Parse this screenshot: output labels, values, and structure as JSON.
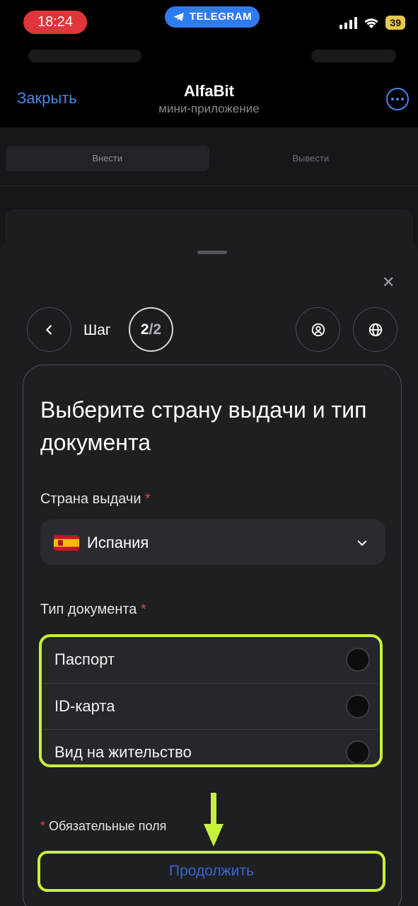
{
  "status_bar": {
    "time": "18:24",
    "app_badge": "TELEGRAM",
    "battery": "39",
    "icons": [
      "signal-icon",
      "wifi-icon",
      "battery-icon",
      "telegram-icon"
    ]
  },
  "header": {
    "close_label": "Закрыть",
    "title": "AlfaBit",
    "subtitle": "мини-приложение",
    "more_icon": "more-icon"
  },
  "background_page": {
    "tabs": [
      {
        "label": "Внести",
        "active": true
      },
      {
        "label": "Вывести",
        "active": false
      }
    ]
  },
  "sheet": {
    "close_icon": "close-icon",
    "step": {
      "label": "Шаг",
      "current": "2",
      "separator": "/",
      "total": "2"
    },
    "icons": [
      "back-icon",
      "profile-icon",
      "globe-icon"
    ],
    "form": {
      "title": "Выберите страну выдачи и тип документа",
      "country_label": "Страна выдачи",
      "required_mark": "*",
      "country_value": "Испания",
      "doc_type_label": "Тип документа",
      "doc_types": [
        {
          "label": "Паспорт",
          "selected": false
        },
        {
          "label": "ID-карта",
          "selected": false
        },
        {
          "label": "Вид на жительство",
          "selected": false
        }
      ],
      "required_note": "Обязательные поля",
      "continue_label": "Продолжить"
    }
  },
  "colors": {
    "accent_blue": "#4a86e8",
    "highlight": "#c6f23a",
    "required": "#d9443a",
    "time_pill": "#e0353b"
  }
}
